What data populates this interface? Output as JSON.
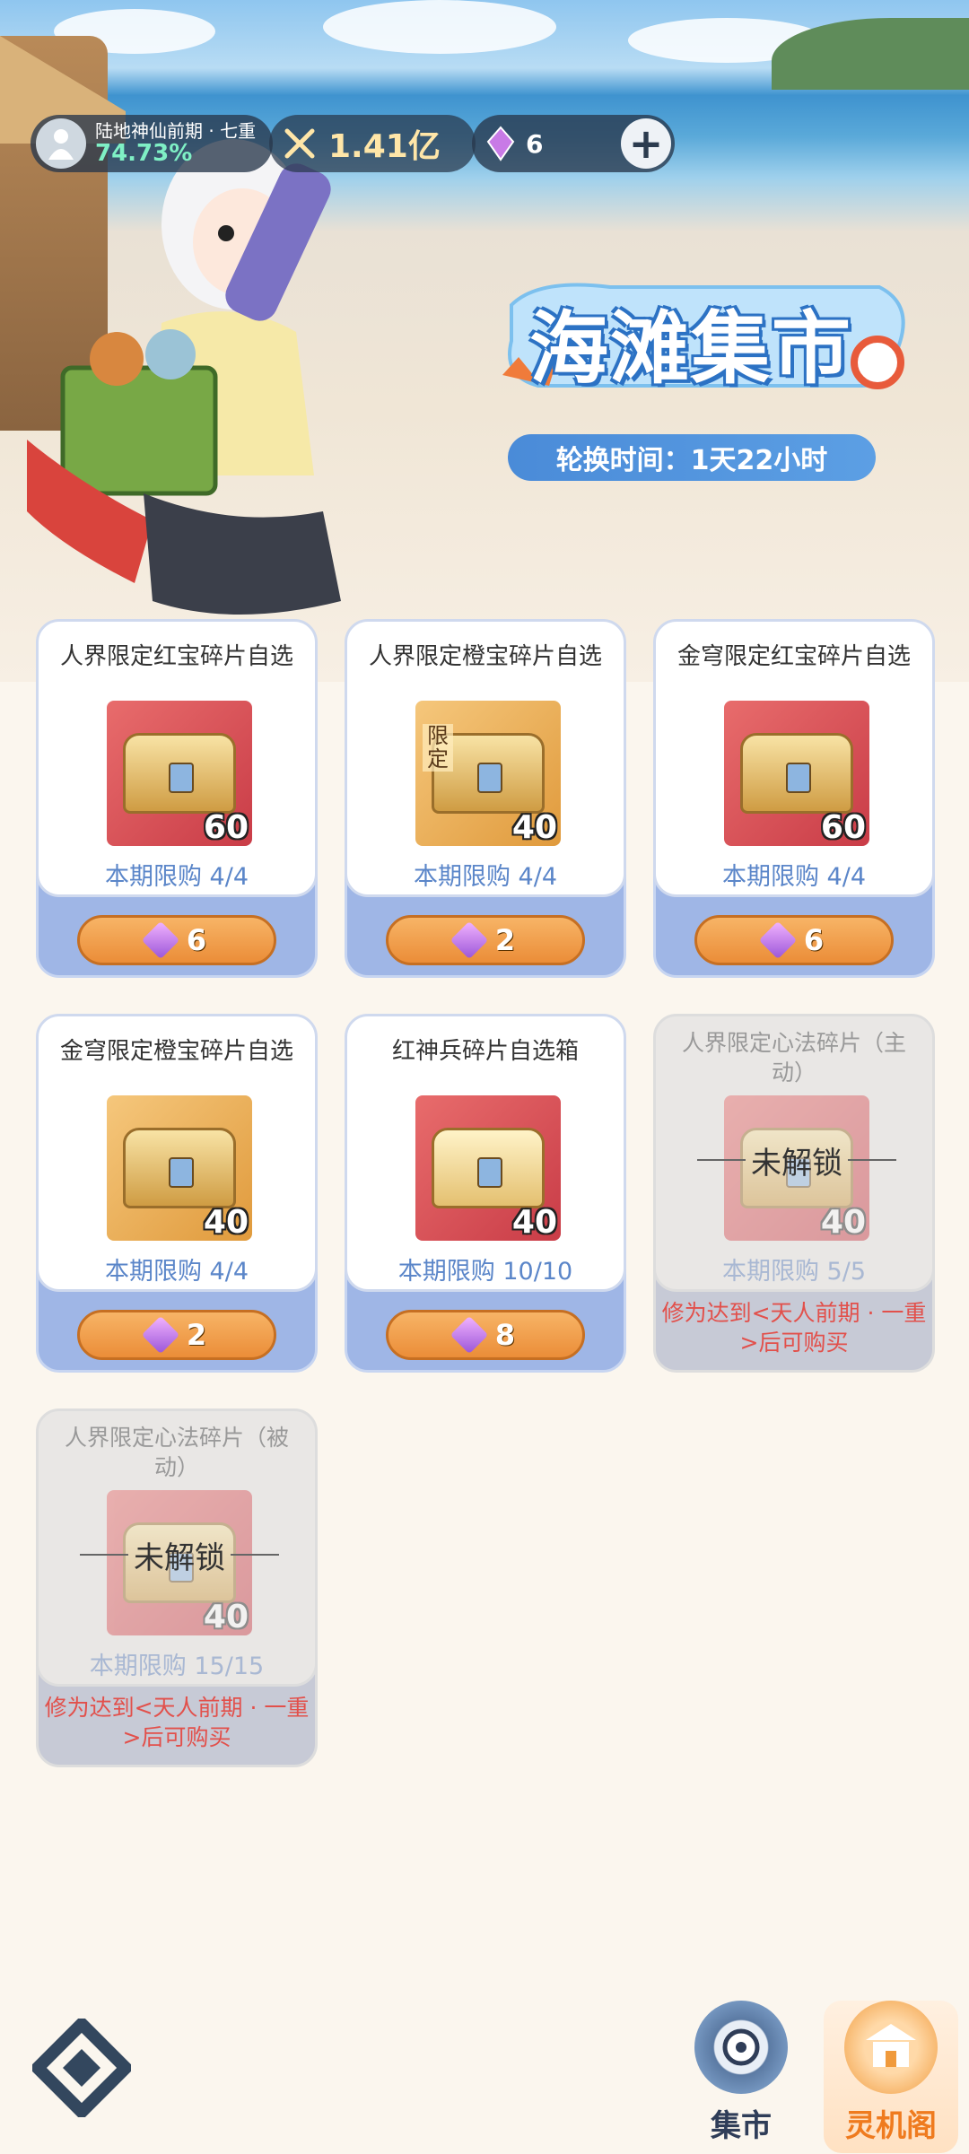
{
  "status": {
    "realm_name": "陆地神仙前期 · 七重",
    "realm_progress": "74.73%",
    "power": "1.41亿",
    "gem_count": "6",
    "add_label": "+"
  },
  "banner": {
    "title": "海滩集市",
    "rotation_text": "轮换时间：1天22小时"
  },
  "shop_items": [
    {
      "name": "人界限定红宝碎片自选",
      "count": "60",
      "quota": "本期限购 4/4",
      "price": "6"
    },
    {
      "name": "人界限定橙宝碎片自选",
      "count": "40",
      "limit_tag": "限定",
      "quota": "本期限购 4/4",
      "price": "2"
    },
    {
      "name": "金穹限定红宝碎片自选",
      "count": "60",
      "quota": "本期限购 4/4",
      "price": "6"
    },
    {
      "name": "金穹限定橙宝碎片自选",
      "count": "40",
      "quota": "本期限购 4/4",
      "price": "2"
    },
    {
      "name": "红神兵碎片自选箱",
      "count": "40",
      "quota": "本期限购 10/10",
      "price": "8"
    },
    {
      "name": "人界限定心法碎片（主动）",
      "count": "40",
      "quota": "本期限购 5/5",
      "lock_text": "未解锁",
      "requirement": "修为达到<天人前期 · 一重>后可购买"
    },
    {
      "name": "人界限定心法碎片（被动）",
      "count": "40",
      "quota": "本期限购 15/15",
      "lock_text": "未解锁",
      "requirement": "修为达到<天人前期 · 一重>后可购买"
    }
  ],
  "nav": {
    "market_label": "集市",
    "pavilion_label": "灵机阁"
  }
}
